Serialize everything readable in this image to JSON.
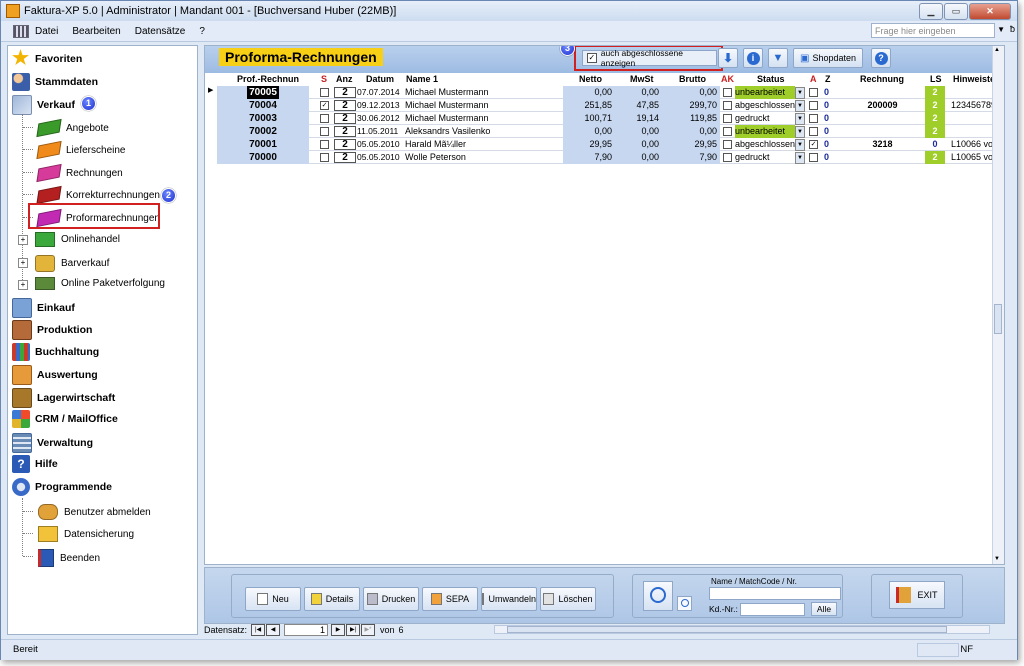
{
  "window": {
    "title": "Faktura-XP 5.0 | Administrator | Mandant 001 - [Buchversand Huber (22MB)]"
  },
  "menubar": {
    "items": [
      "Datei",
      "Bearbeiten",
      "Datensätze",
      "?"
    ],
    "help_placeholder": "Frage hier eingeben"
  },
  "sidebar": {
    "favoriten": "Favoriten",
    "stammdaten": "Stammdaten",
    "verkauf": "Verkauf",
    "verkauf_items": [
      "Angebote",
      "Lieferscheine",
      "Rechnungen",
      "Korrekturrechnungen",
      "Proformarechnungen"
    ],
    "verkauf_groups": [
      "Onlinehandel",
      "Barverkauf",
      "Online Paketverfolgung"
    ],
    "sections": [
      "Einkauf",
      "Produktion",
      "Buchhaltung",
      "Auswertung",
      "Lagerwirtschaft",
      "CRM / MailOffice",
      "Verwaltung",
      "Hilfe",
      "Programmende"
    ],
    "programmende_items": [
      "Benutzer abmelden",
      "Datensicherung",
      "Beenden"
    ]
  },
  "badges": [
    "1",
    "2",
    "3"
  ],
  "main": {
    "title": "Proforma-Rechnungen",
    "show_closed_label": "auch abgeschlossene anzeigen",
    "shopdaten_label": "Shopdaten",
    "columns": [
      "Prof.-Rechnung",
      "S",
      "Anz",
      "Datum",
      "Name 1",
      "Netto",
      "MwSt",
      "Brutto",
      "AK",
      "Status",
      "A",
      "Z",
      "Rechnung",
      "LS",
      "Hinweiste"
    ],
    "rows": [
      {
        "nr": "70005",
        "s": "",
        "anz": "2",
        "datum": "07.07.2014",
        "name": "Michael Mustermann",
        "netto": "0,00",
        "mwst": "0,00",
        "brutto": "0,00",
        "ak": "",
        "status": "unbearbeitet",
        "a": "",
        "z": "0",
        "rechnung": "",
        "ls": "2",
        "hinweis": ""
      },
      {
        "nr": "70004",
        "s": "✓",
        "anz": "2",
        "datum": "09.12.2013",
        "name": "Michael Mustermann",
        "netto": "251,85",
        "mwst": "47,85",
        "brutto": "299,70",
        "ak": "",
        "status": "abgeschlossen",
        "a": "",
        "z": "0",
        "rechnung": "200009",
        "ls": "2",
        "hinweis": "123456789"
      },
      {
        "nr": "70003",
        "s": "",
        "anz": "2",
        "datum": "30.06.2012",
        "name": "Michael Mustermann",
        "netto": "100,71",
        "mwst": "19,14",
        "brutto": "119,85",
        "ak": "",
        "status": "gedruckt",
        "a": "",
        "z": "0",
        "rechnung": "",
        "ls": "2",
        "hinweis": ""
      },
      {
        "nr": "70002",
        "s": "",
        "anz": "2",
        "datum": "11.05.2011",
        "name": "Aleksandrs Vasilenko",
        "netto": "0,00",
        "mwst": "0,00",
        "brutto": "0,00",
        "ak": "",
        "status": "unbearbeitet",
        "a": "",
        "z": "0",
        "rechnung": "",
        "ls": "2",
        "hinweis": ""
      },
      {
        "nr": "70001",
        "s": "",
        "anz": "2",
        "datum": "05.05.2010",
        "name": "Harald Mã¼ller",
        "netto": "29,95",
        "mwst": "0,00",
        "brutto": "29,95",
        "ak": "",
        "status": "abgeschlossen",
        "a": "✓",
        "z": "0",
        "rechnung": "3218",
        "ls": "0",
        "hinweis": "L10066 vo"
      },
      {
        "nr": "70000",
        "s": "",
        "anz": "2",
        "datum": "05.05.2010",
        "name": "Wolle Peterson",
        "netto": "7,90",
        "mwst": "0,00",
        "brutto": "7,90",
        "ak": "",
        "status": "gedruckt",
        "a": "",
        "z": "0",
        "rechnung": "",
        "ls": "2",
        "hinweis": "L10065 vo"
      }
    ]
  },
  "actions": [
    "Neu",
    "Details",
    "Drucken",
    "SEPA",
    "Umwandeln",
    "Löschen"
  ],
  "search": {
    "label": "Name / MatchCode / Nr.",
    "kd_label": "Kd.-Nr.:",
    "alle_label": "Alle"
  },
  "exit_label": "EXIT",
  "nav": {
    "label": "Datensatz:",
    "current": "1",
    "of_label": "von",
    "total": "6"
  },
  "status": {
    "text": "Bereit",
    "nf": "NF"
  }
}
